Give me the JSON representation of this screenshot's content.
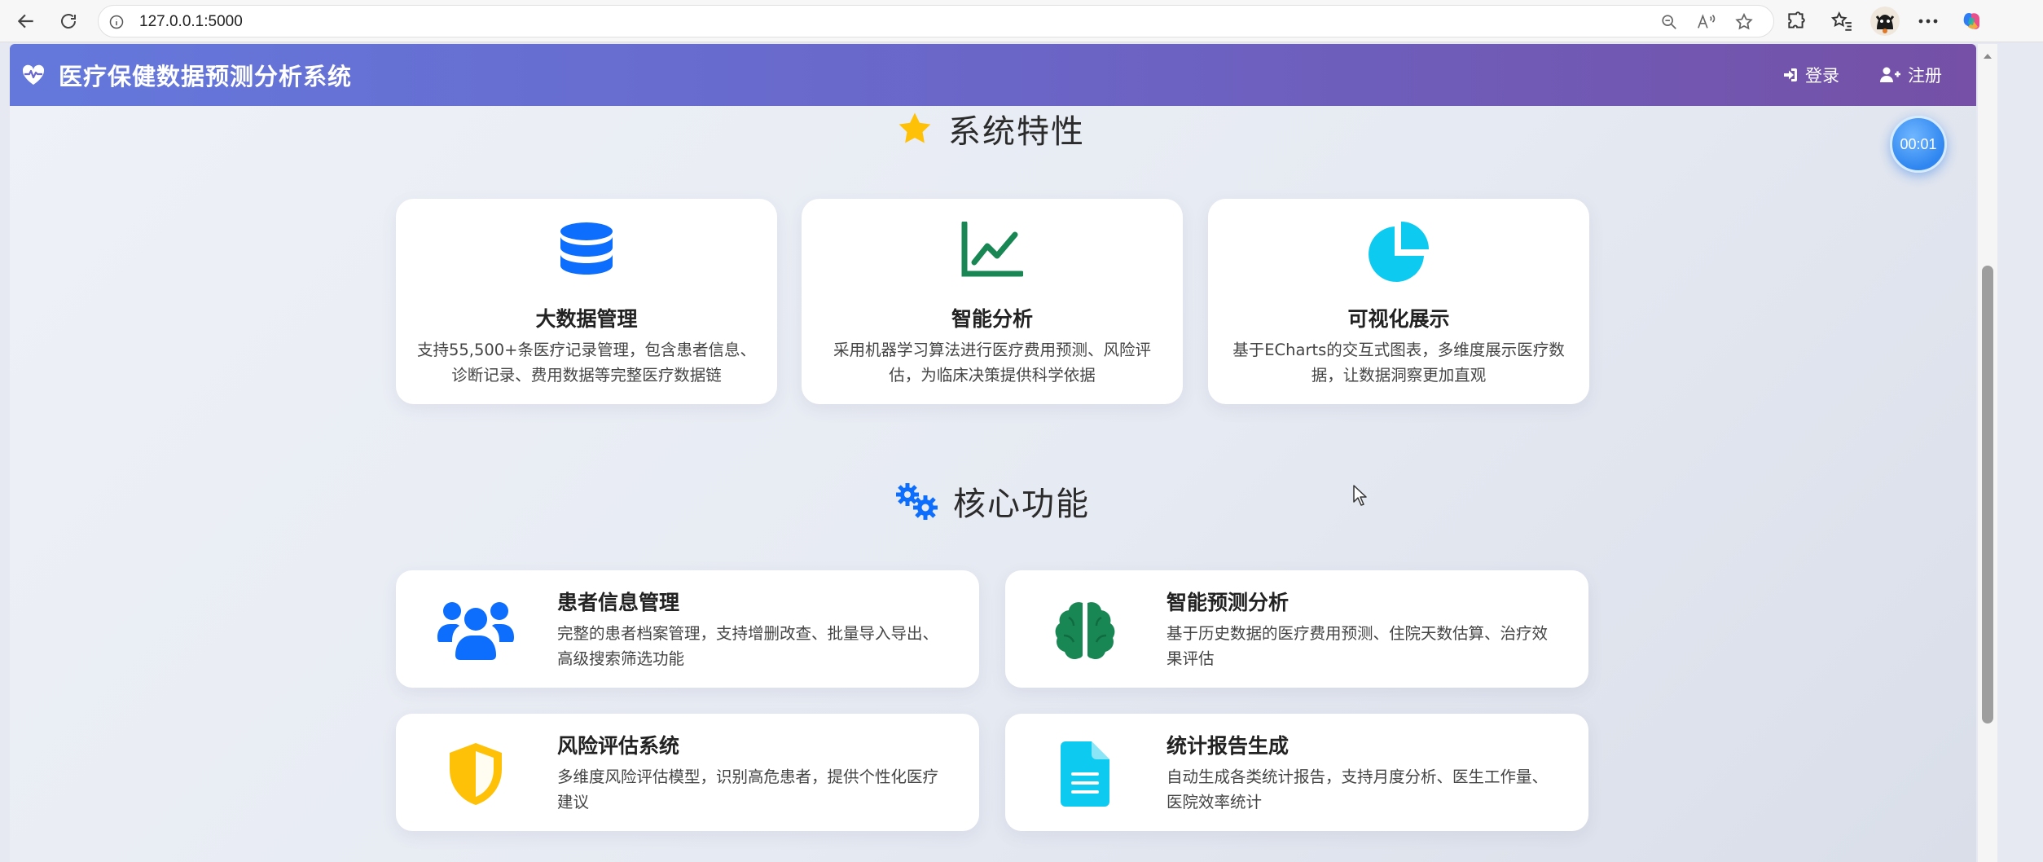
{
  "browser": {
    "url": "127.0.0.1:5000"
  },
  "header": {
    "title": "医疗保健数据预测分析系统",
    "login_label": "登录",
    "register_label": "注册"
  },
  "timer": {
    "text": "00:01"
  },
  "features_section": {
    "title": "系统特性",
    "cards": [
      {
        "icon": "database-icon",
        "title": "大数据管理",
        "desc_line1": "支持55,500+条医疗记录管理，包含患者信息、",
        "desc_line2": "诊断记录、费用数据等完整医疗数据链",
        "color": "#0d6efd"
      },
      {
        "icon": "line-chart-icon",
        "title": "智能分析",
        "desc_line1": "采用机器学习算法进行医疗费用预测、风险评",
        "desc_line2": "估，为临床决策提供科学依据",
        "color": "#198754"
      },
      {
        "icon": "pie-chart-icon",
        "title": "可视化展示",
        "desc_line1": "基于ECharts的交互式图表，多维度展示医疗数",
        "desc_line2": "据，让数据洞察更加直观",
        "color": "#0dcaf0"
      }
    ]
  },
  "core_section": {
    "title": "核心功能",
    "cards": [
      {
        "icon": "users-icon",
        "title": "患者信息管理",
        "desc_line1": "完整的患者档案管理，支持增删改查、批量导入导出、",
        "desc_line2": "高级搜索筛选功能",
        "color": "#0d6efd"
      },
      {
        "icon": "brain-icon",
        "title": "智能预测分析",
        "desc_line1": "基于历史数据的医疗费用预测、住院天数估算、治疗效",
        "desc_line2": "果评估",
        "color": "#198754"
      },
      {
        "icon": "shield-icon",
        "title": "风险评估系统",
        "desc_line1": "多维度风险评估模型，识别高危患者，提供个性化医疗",
        "desc_line2": "建议",
        "color": "#ffc107"
      },
      {
        "icon": "file-report-icon",
        "title": "统计报告生成",
        "desc_line1": "自动生成各类统计报告，支持月度分析、医生工作量、",
        "desc_line2": "医院效率统计",
        "color": "#0dcaf0"
      }
    ]
  }
}
